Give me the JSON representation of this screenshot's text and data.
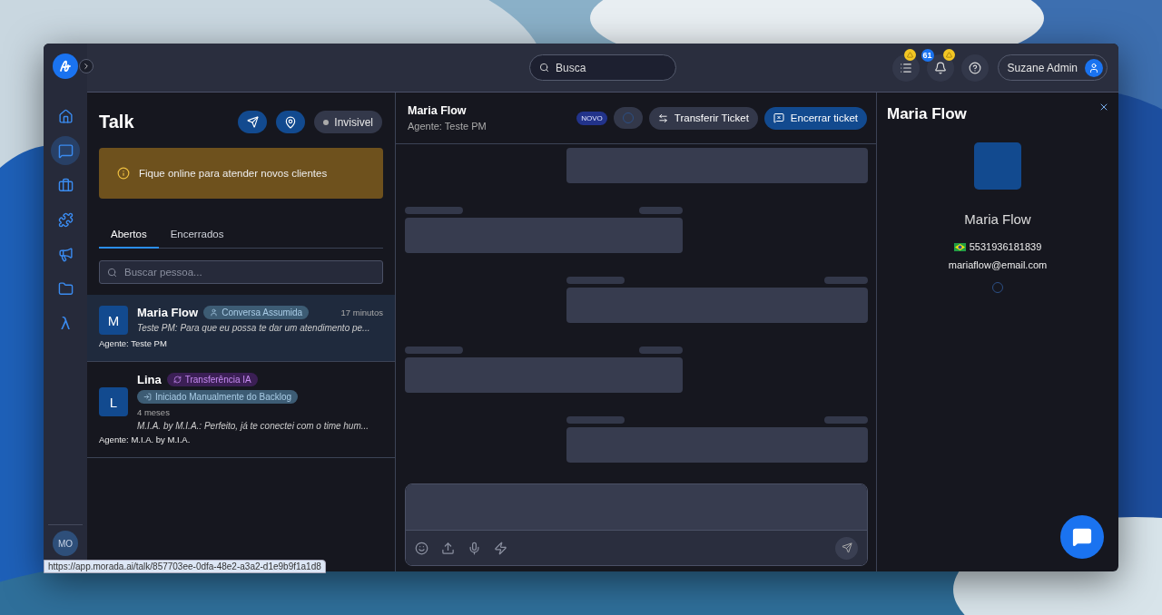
{
  "topbar": {
    "search": {
      "placeholder": "Busca"
    },
    "icons": [
      {
        "kind": "list",
        "warning": true
      },
      {
        "kind": "bell",
        "badge": "61",
        "warning": true
      },
      {
        "kind": "help",
        "warning": false
      }
    ],
    "user": {
      "name": "Suzane Admin"
    }
  },
  "sidebar": {
    "items": [
      {
        "kind": "home",
        "selected": false
      },
      {
        "kind": "chat",
        "selected": true
      },
      {
        "kind": "briefcase",
        "selected": false
      },
      {
        "kind": "puzzle",
        "selected": false
      },
      {
        "kind": "megaphone",
        "selected": false
      },
      {
        "kind": "folder",
        "selected": false
      },
      {
        "kind": "text",
        "label": "λ",
        "selected": false
      }
    ],
    "avatar": "MO"
  },
  "talk": {
    "title": "Talk",
    "status": "Invisivel",
    "alert": "Fique online para atender novos clientes",
    "tabs": [
      {
        "label": "Abertos",
        "selected": true
      },
      {
        "label": "Encerrados",
        "selected": false
      }
    ],
    "search": {
      "placeholder": "Buscar pessoa..."
    },
    "conversations": [
      {
        "initial": "M",
        "name": "Maria Flow",
        "tags": [
          {
            "kind": "assumed",
            "label": "Conversa Assumida"
          }
        ],
        "time": "17 minutos",
        "preview": "Teste PM: Para que eu possa te dar um atendimento pe...",
        "agent": "Agente: Teste PM",
        "selected": true
      },
      {
        "initial": "L",
        "name": "Lina",
        "tags": [
          {
            "kind": "ai",
            "label": "Transferência IA"
          },
          {
            "kind": "manual",
            "label": "Iniciado Manualmente do Backlog"
          }
        ],
        "time": "4 meses",
        "preview": "M.I.A. by M.I.A.: Perfeito, já te conectei com o time hum...",
        "agent": "Agente: M.I.A. by M.I.A.",
        "selected": false
      }
    ]
  },
  "chat": {
    "name": "Maria Flow",
    "agent": "Agente: Teste PM",
    "badge": "NOVO",
    "transfer": "Transferir Ticket",
    "close": "Encerrar ticket"
  },
  "contact": {
    "title": "Maria Flow",
    "name": "Maria Flow",
    "phone": "5531936181839",
    "email": "mariaflow@email.com"
  },
  "status_url": "https://app.morada.ai/talk/857703ee-0dfa-48e2-a3a2-d1e9b9f1a1d8"
}
